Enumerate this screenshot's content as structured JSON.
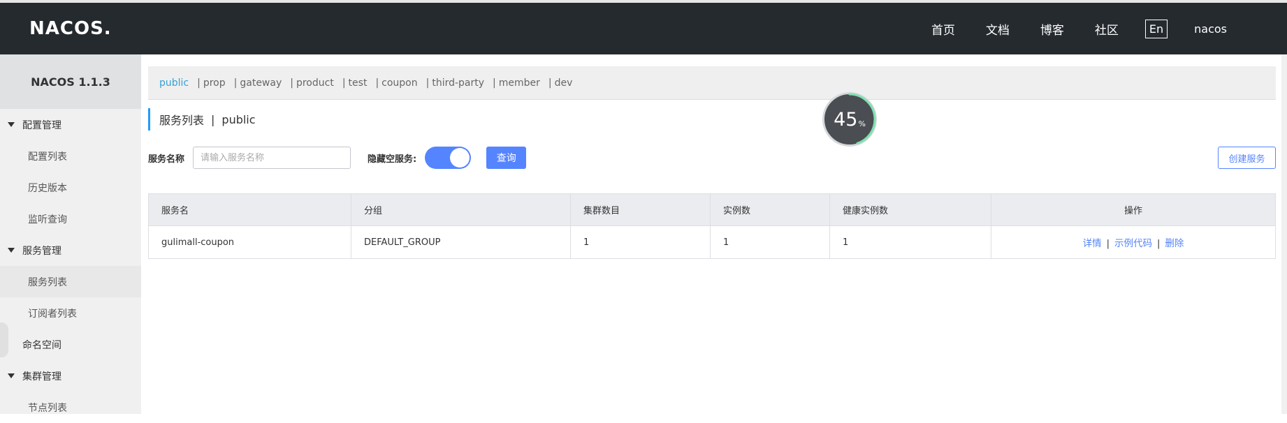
{
  "header": {
    "logo": "NACOS.",
    "nav": [
      "首页",
      "文档",
      "博客",
      "社区"
    ],
    "lang": "En",
    "user": "nacos"
  },
  "sidebar": {
    "version": "NACOS 1.1.3",
    "groups": [
      {
        "label": "配置管理",
        "items": [
          "配置列表",
          "历史版本",
          "监听查询"
        ]
      },
      {
        "label": "服务管理",
        "items": [
          "服务列表",
          "订阅者列表"
        ]
      }
    ],
    "namespace": "命名空间",
    "cluster": {
      "label": "集群管理",
      "items": [
        "节点列表"
      ]
    },
    "active_item": "服务列表"
  },
  "namespaces": {
    "items": [
      "public",
      "prop",
      "gateway",
      "product",
      "test",
      "coupon",
      "third-party",
      "member",
      "dev"
    ],
    "active": "public"
  },
  "page": {
    "title": "服务列表",
    "namespace": "public",
    "divider": "|"
  },
  "search": {
    "service_label": "服务名称",
    "service_placeholder": "请输入服务名称",
    "hide_empty_label": "隐藏空服务:",
    "hide_empty_on": true,
    "query_button": "查询",
    "create_button": "创建服务"
  },
  "table": {
    "columns": [
      "服务名",
      "分组",
      "集群数目",
      "实例数",
      "健康实例数",
      "操作"
    ],
    "rows": [
      {
        "name": "gulimall-coupon",
        "group": "DEFAULT_GROUP",
        "clusters": "1",
        "instances": "1",
        "healthy": "1",
        "ops": [
          "详情",
          "示例代码",
          "删除"
        ]
      }
    ]
  },
  "loader": {
    "value": "45",
    "unit": "%",
    "progress": 0.45
  },
  "colors": {
    "header_bg": "#252a2f",
    "accent": "#5584ff",
    "active_ns": "#33a1d6",
    "sidebar_bg": "#f0f0f0"
  }
}
